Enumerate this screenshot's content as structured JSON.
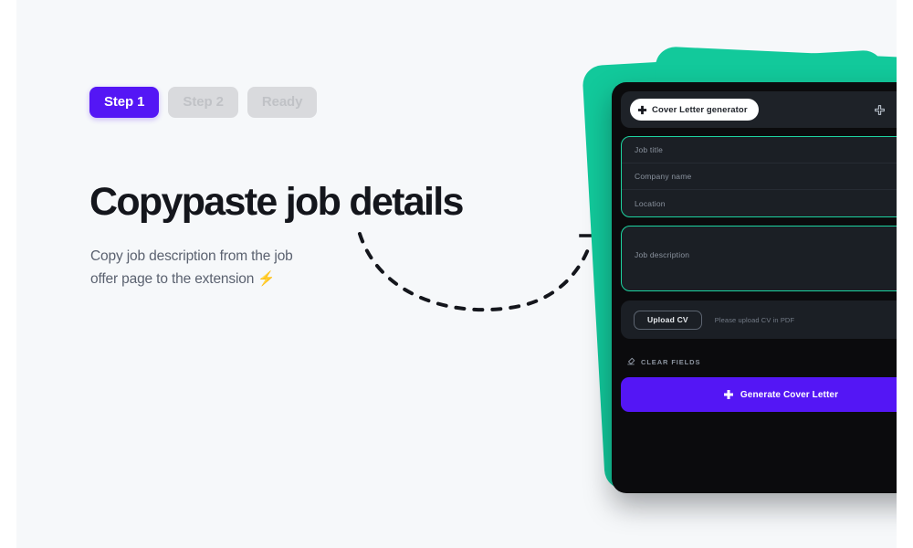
{
  "theme": {
    "accent_purple": "#5416f5",
    "accent_teal": "#12c99b",
    "field_border_green": "#1dd3a0",
    "panel_dark": "#0b0b0d",
    "page_background": "#f6f8fa"
  },
  "steps": [
    {
      "label": "Step 1",
      "state": "active"
    },
    {
      "label": "Step 2",
      "state": "inactive"
    },
    {
      "label": "Ready",
      "state": "inactive"
    }
  ],
  "hero": {
    "headline": "Copypaste job details",
    "body_line_1": "Copy job description from the job",
    "body_line_2": "offer page to the extension",
    "body_emoji": "⚡"
  },
  "extension": {
    "header": {
      "brand_label": "Cover Letter generator",
      "brand_icon": "plus-icon",
      "icons": [
        "move-icon",
        "bookmark-icon",
        "person-icon"
      ]
    },
    "fields": [
      {
        "placeholder": "Job title"
      },
      {
        "placeholder": "Company name"
      },
      {
        "placeholder": "Location"
      }
    ],
    "description": {
      "placeholder": "Job description"
    },
    "upload": {
      "button_label": "Upload CV",
      "hint": "Please upload CV in PDF"
    },
    "clear": {
      "label": "CLEAR FIELDS",
      "icon": "eraser-icon"
    },
    "cta": {
      "label": "Generate Cover Letter",
      "icon": "plus-icon"
    }
  }
}
